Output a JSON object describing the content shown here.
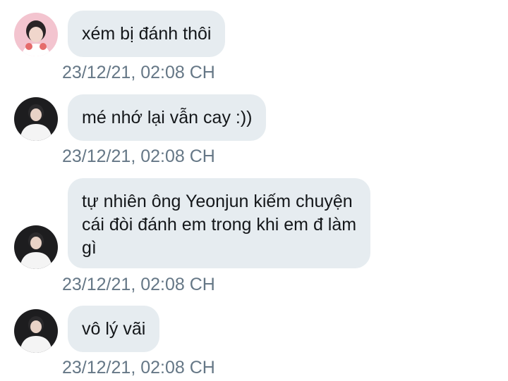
{
  "messages": [
    {
      "avatar_icon": "avatar-pink-bg-icon",
      "lines": [
        "xém bị đánh thôi"
      ],
      "timestamp": "23/12/21, 02:08 CH"
    },
    {
      "avatar_icon": "avatar-dark-icon",
      "lines": [
        "mé nhớ lại vẫn cay :))"
      ],
      "timestamp": "23/12/21, 02:08 CH"
    },
    {
      "avatar_icon": "avatar-dark-icon",
      "lines": [
        "tự nhiên ông Yeonjun kiếm chuyện",
        "cái đòi đánh em trong khi em đ làm",
        "gì"
      ],
      "timestamp": "23/12/21, 02:08 CH"
    },
    {
      "avatar_icon": "avatar-dark-icon",
      "lines": [
        "vô lý vãi"
      ],
      "timestamp": "23/12/21, 02:08 CH"
    }
  ],
  "colors": {
    "bubble_bg": "#e6ecf0",
    "text": "#14171a",
    "timestamp": "#657786"
  }
}
